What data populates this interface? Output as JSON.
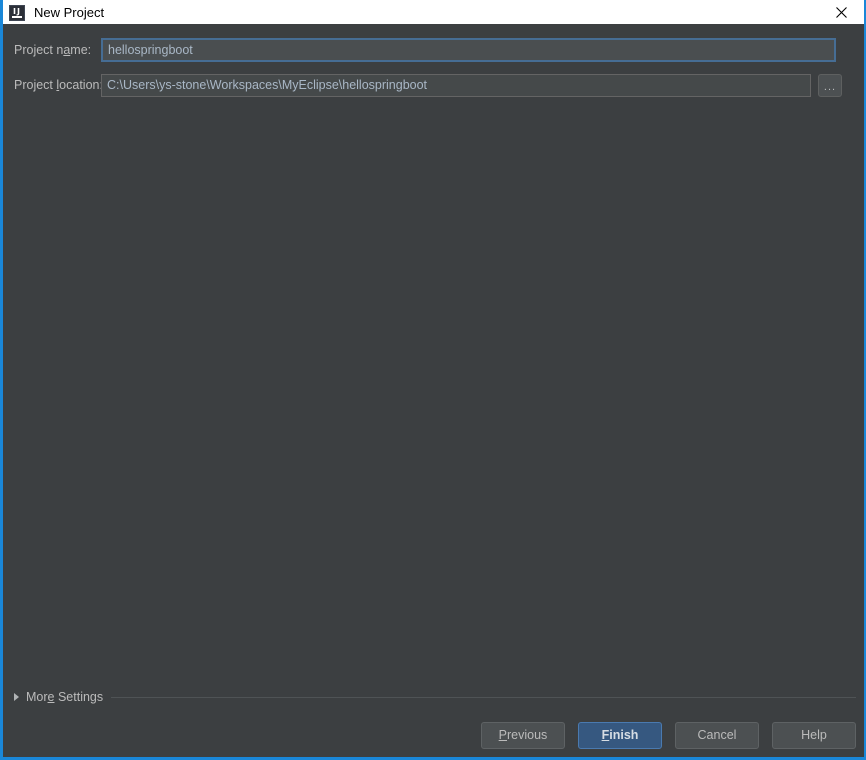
{
  "window": {
    "title": "New Project",
    "icon": "intellij-idea-icon",
    "close_icon": "close-icon",
    "accent_color": "#1a87d8",
    "titlebar_bg": "#ffffff",
    "content_bg": "#3c3f41"
  },
  "form": {
    "project_name": {
      "label_prefix": "Project n",
      "label_mnemonic": "a",
      "label_suffix": "me:",
      "value": "hellospringboot",
      "placeholder": ""
    },
    "project_location": {
      "label_prefix": "Project ",
      "label_mnemonic": "l",
      "label_suffix": "ocation:",
      "value": "C:\\Users\\ys-stone\\Workspaces\\MyEclipse\\hellospringboot",
      "placeholder": "",
      "browse_label": "...",
      "browse_icon": "ellipsis-icon"
    }
  },
  "more_settings": {
    "label_prefix": "Mor",
    "label_mnemonic": "e",
    "label_suffix": " Settings",
    "expanded": false,
    "disclosure_icon": "chevron-right-icon"
  },
  "buttons": [
    {
      "name": "previous-button",
      "prefix": "",
      "mnemonic": "P",
      "suffix": "revious",
      "primary": false
    },
    {
      "name": "finish-button",
      "prefix": "",
      "mnemonic": "F",
      "suffix": "inish",
      "primary": true
    },
    {
      "name": "cancel-button",
      "prefix": "Cancel",
      "mnemonic": "",
      "suffix": "",
      "primary": false
    },
    {
      "name": "help-button",
      "prefix": "Help",
      "mnemonic": "",
      "suffix": "",
      "primary": false
    }
  ]
}
